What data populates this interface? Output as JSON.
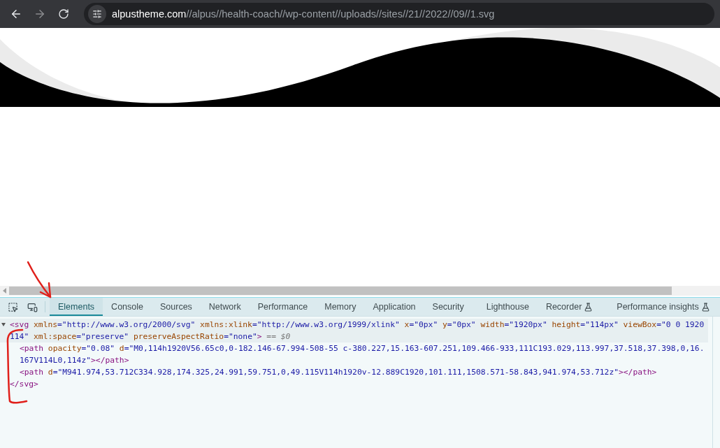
{
  "browser": {
    "url_host": "alpustheme.com",
    "url_path": "//alpus//health-coach//wp-content//uploads//sites//21//2022//09//1.svg"
  },
  "devtools": {
    "tabs": [
      {
        "label": "Elements",
        "selected": true,
        "experimental": false
      },
      {
        "label": "Console",
        "selected": false,
        "experimental": false
      },
      {
        "label": "Sources",
        "selected": false,
        "experimental": false
      },
      {
        "label": "Network",
        "selected": false,
        "experimental": false
      },
      {
        "label": "Performance",
        "selected": false,
        "experimental": false
      },
      {
        "label": "Memory",
        "selected": false,
        "experimental": false
      },
      {
        "label": "Application",
        "selected": false,
        "experimental": false
      },
      {
        "label": "Security",
        "selected": false,
        "experimental": false
      },
      {
        "label": "Lighthouse",
        "selected": false,
        "experimental": false
      },
      {
        "label": "Recorder",
        "selected": false,
        "experimental": true
      },
      {
        "label": "Performance insights",
        "selected": false,
        "experimental": true
      }
    ],
    "dom": [
      {
        "open": "<svg",
        "selected": true,
        "expanded": true,
        "attrs": [
          {
            "name": "xmlns",
            "value": "=\"http://www.w3.org/2000/svg\""
          },
          {
            "name": "xmlns:xlink",
            "value": "=\"http://www.w3.org/1999/xlink\""
          },
          {
            "name": "x",
            "value": "=\"0px\""
          },
          {
            "name": "y",
            "value": "=\"0px\""
          },
          {
            "name": "width",
            "value": "=\"1920px\""
          },
          {
            "name": "height",
            "value": "=\"114px\""
          },
          {
            "name": "viewBox",
            "value": "=\"0 0 1920 114\""
          },
          {
            "name": "xml:space",
            "value": "=\"preserve\""
          },
          {
            "name": "preserveAspectRatio",
            "value": "=\"none\""
          }
        ],
        "end": ">",
        "note": "== $0",
        "children": [
          {
            "open": "<path",
            "selected": false,
            "attrs": [
              {
                "name": "opacity",
                "value": "=\"0.08\""
              },
              {
                "name": "d",
                "value": "=\"M0,114h1920V56.65c0,0-182.146-67.994-508-55 c-380.227,15.163-607.251,109.466-933,111C193.029,113.997,37.518,37.398,0,16.167V114L0,114z\""
              }
            ],
            "end": ">",
            "close": "</path>"
          },
          {
            "open": "<path",
            "selected": false,
            "attrs": [
              {
                "name": "d",
                "value": "=\"M941.974,53.712C334.928,174.325,24.991,59.751,0,49.115V114h1920v-12.889C1920,101.111,1508.571-58.843,941.974,53.712z\""
              }
            ],
            "end": ">",
            "close": "</path>"
          }
        ],
        "close": "</svg>"
      }
    ]
  }
}
